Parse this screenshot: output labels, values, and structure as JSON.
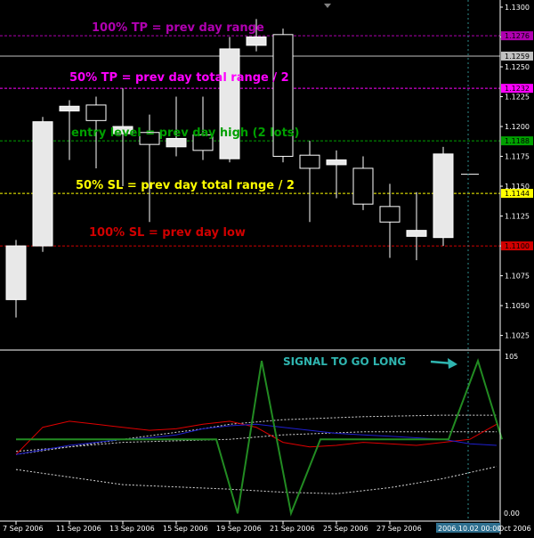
{
  "chart_data": {
    "type": "candlestick",
    "y_range": [
      1.1015,
      1.13
    ],
    "price_ticks": [
      "1.1300",
      "1.1275",
      "1.1250",
      "1.1225",
      "1.1200",
      "1.1175",
      "1.1150",
      "1.1125",
      "1.1100",
      "1.1075",
      "1.1050",
      "1.1025"
    ],
    "date_labels": [
      {
        "label": "7 Sep 2006",
        "index": 0
      },
      {
        "label": "11 Sep 2006",
        "index": 2
      },
      {
        "label": "13 Sep 2006",
        "index": 4
      },
      {
        "label": "15 Sep 2006",
        "index": 6
      },
      {
        "label": "19 Sep 2006",
        "index": 8
      },
      {
        "label": "21 Sep 2006",
        "index": 10
      },
      {
        "label": "25 Sep 2006",
        "index": 12
      },
      {
        "label": "27 Sep 2006",
        "index": 14
      }
    ],
    "current_time_label": "2006.10.02 00:00",
    "last_date_label": "Oct 2006",
    "candles": [
      {
        "open": 1.1055,
        "high": 1.1105,
        "low": 1.104,
        "close": 1.11
      },
      {
        "open": 1.11,
        "high": 1.1208,
        "low": 1.1095,
        "close": 1.1204
      },
      {
        "open": 1.1213,
        "high": 1.1222,
        "low": 1.1172,
        "close": 1.1217
      },
      {
        "open": 1.1218,
        "high": 1.1225,
        "low": 1.1165,
        "close": 1.1205
      },
      {
        "open": 1.1194,
        "high": 1.1232,
        "low": 1.115,
        "close": 1.12
      },
      {
        "open": 1.1195,
        "high": 1.121,
        "low": 1.112,
        "close": 1.1185
      },
      {
        "open": 1.1183,
        "high": 1.1225,
        "low": 1.1175,
        "close": 1.119
      },
      {
        "open": 1.1193,
        "high": 1.1225,
        "low": 1.1172,
        "close": 1.118
      },
      {
        "open": 1.1173,
        "high": 1.1275,
        "low": 1.117,
        "close": 1.1265
      },
      {
        "open": 1.1268,
        "high": 1.129,
        "low": 1.1263,
        "close": 1.1275
      },
      {
        "open": 1.1277,
        "high": 1.1282,
        "low": 1.117,
        "close": 1.1175
      },
      {
        "open": 1.1176,
        "high": 1.1188,
        "low": 1.112,
        "close": 1.1165
      },
      {
        "open": 1.1168,
        "high": 1.118,
        "low": 1.114,
        "close": 1.1172
      },
      {
        "open": 1.1165,
        "high": 1.1175,
        "low": 1.113,
        "close": 1.1135
      },
      {
        "open": 1.1133,
        "high": 1.1152,
        "low": 1.109,
        "close": 1.112
      },
      {
        "open": 1.1108,
        "high": 1.1145,
        "low": 1.1088,
        "close": 1.1113
      },
      {
        "open": 1.1107,
        "high": 1.1183,
        "low": 1.11,
        "close": 1.1177
      },
      {
        "open": 1.116,
        "high": 1.116,
        "low": 1.116,
        "close": 1.116
      }
    ],
    "levels": [
      {
        "name": "tp100",
        "label": "100% TP = prev day range",
        "price": 1.1276,
        "tag": "1.1276",
        "color": "#b000b0",
        "style": "dashed"
      },
      {
        "name": "current-price",
        "label": "",
        "price": 1.1259,
        "tag": "1.1259",
        "color": "#c0c0c0",
        "style": "solid"
      },
      {
        "name": "tp50",
        "label": "50% TP = prev day total range / 2",
        "price": 1.1232,
        "tag": "1.1232",
        "color": "#ff00ff",
        "style": "dashed"
      },
      {
        "name": "entry",
        "label": "entry level = prev day high (2 lots)",
        "price": 1.1188,
        "tag": "1.1188",
        "color": "#00a000",
        "style": "dashed"
      },
      {
        "name": "sl50",
        "label": "50% SL = prev day total range / 2",
        "price": 1.1144,
        "tag": "1.1144",
        "color": "#ffff00",
        "style": "dashed"
      },
      {
        "name": "sl100",
        "label": "100% SL = prev day low",
        "price": 1.11,
        "tag": "1.1100",
        "color": "#d00000",
        "style": "dashed"
      }
    ],
    "indicator": {
      "y_range": [
        0,
        105
      ],
      "ticks": [
        "105",
        "0.00"
      ],
      "signal_label": "SIGNAL TO GO LONG",
      "green_values": [
        50,
        50,
        50,
        50,
        50,
        50,
        50,
        50,
        50,
        50,
        50,
        50,
        50,
        50,
        50,
        50,
        50,
        50
      ],
      "green_points": [
        [
          0,
          50
        ],
        [
          7.5,
          50
        ],
        [
          8.3,
          1
        ],
        [
          9.2,
          102
        ],
        [
          10.3,
          1
        ],
        [
          11.4,
          50
        ],
        [
          16.2,
          50
        ],
        [
          17.3,
          102
        ],
        [
          18.2,
          50
        ]
      ],
      "red_points": [
        [
          0,
          40
        ],
        [
          1,
          58
        ],
        [
          2,
          62
        ],
        [
          3,
          60
        ],
        [
          4,
          58
        ],
        [
          5,
          56
        ],
        [
          6,
          57
        ],
        [
          7,
          60
        ],
        [
          8,
          62
        ],
        [
          9,
          58
        ],
        [
          10,
          48
        ],
        [
          11,
          45
        ],
        [
          12,
          46
        ],
        [
          13,
          48
        ],
        [
          14,
          47
        ],
        [
          15,
          46
        ],
        [
          16,
          48
        ],
        [
          17,
          50
        ],
        [
          18,
          60
        ]
      ],
      "blue_points": [
        [
          0,
          40
        ],
        [
          1,
          43
        ],
        [
          2,
          46
        ],
        [
          3,
          48
        ],
        [
          4,
          50
        ],
        [
          5,
          51
        ],
        [
          6,
          53
        ],
        [
          7,
          57
        ],
        [
          8,
          59
        ],
        [
          9,
          60
        ],
        [
          10,
          58
        ],
        [
          11,
          56
        ],
        [
          12,
          54
        ],
        [
          13,
          53
        ],
        [
          14,
          52
        ],
        [
          15,
          51
        ],
        [
          16,
          50
        ],
        [
          17,
          47
        ],
        [
          18,
          46
        ]
      ],
      "white_upper": [
        [
          0,
          40
        ],
        [
          4,
          50
        ],
        [
          7,
          57
        ],
        [
          8,
          60
        ],
        [
          10,
          63
        ],
        [
          13,
          65
        ],
        [
          16,
          66
        ],
        [
          17,
          66
        ],
        [
          18,
          66
        ]
      ],
      "white_lower": [
        [
          0,
          30
        ],
        [
          4,
          20
        ],
        [
          8,
          17
        ],
        [
          10,
          15
        ],
        [
          12,
          14
        ],
        [
          14,
          18
        ],
        [
          16,
          24
        ],
        [
          17,
          28
        ],
        [
          18,
          32
        ]
      ],
      "white_mid": [
        [
          0,
          42
        ],
        [
          4,
          48
        ],
        [
          8,
          50
        ],
        [
          10,
          53
        ],
        [
          13,
          55
        ],
        [
          16,
          55
        ],
        [
          18,
          55
        ]
      ]
    },
    "colors": {
      "background": "#000000",
      "candle_bull": "#e8e8e8",
      "candle_bear": "#000000",
      "candle_outline": "#ffffff",
      "axis": "#ffffff",
      "green_line": "#228b22",
      "red_line": "#e00000",
      "blue_line": "#1f1fd0",
      "white_dotted": "#d8d8d8",
      "current_time_line": "#2e8b8b"
    }
  }
}
